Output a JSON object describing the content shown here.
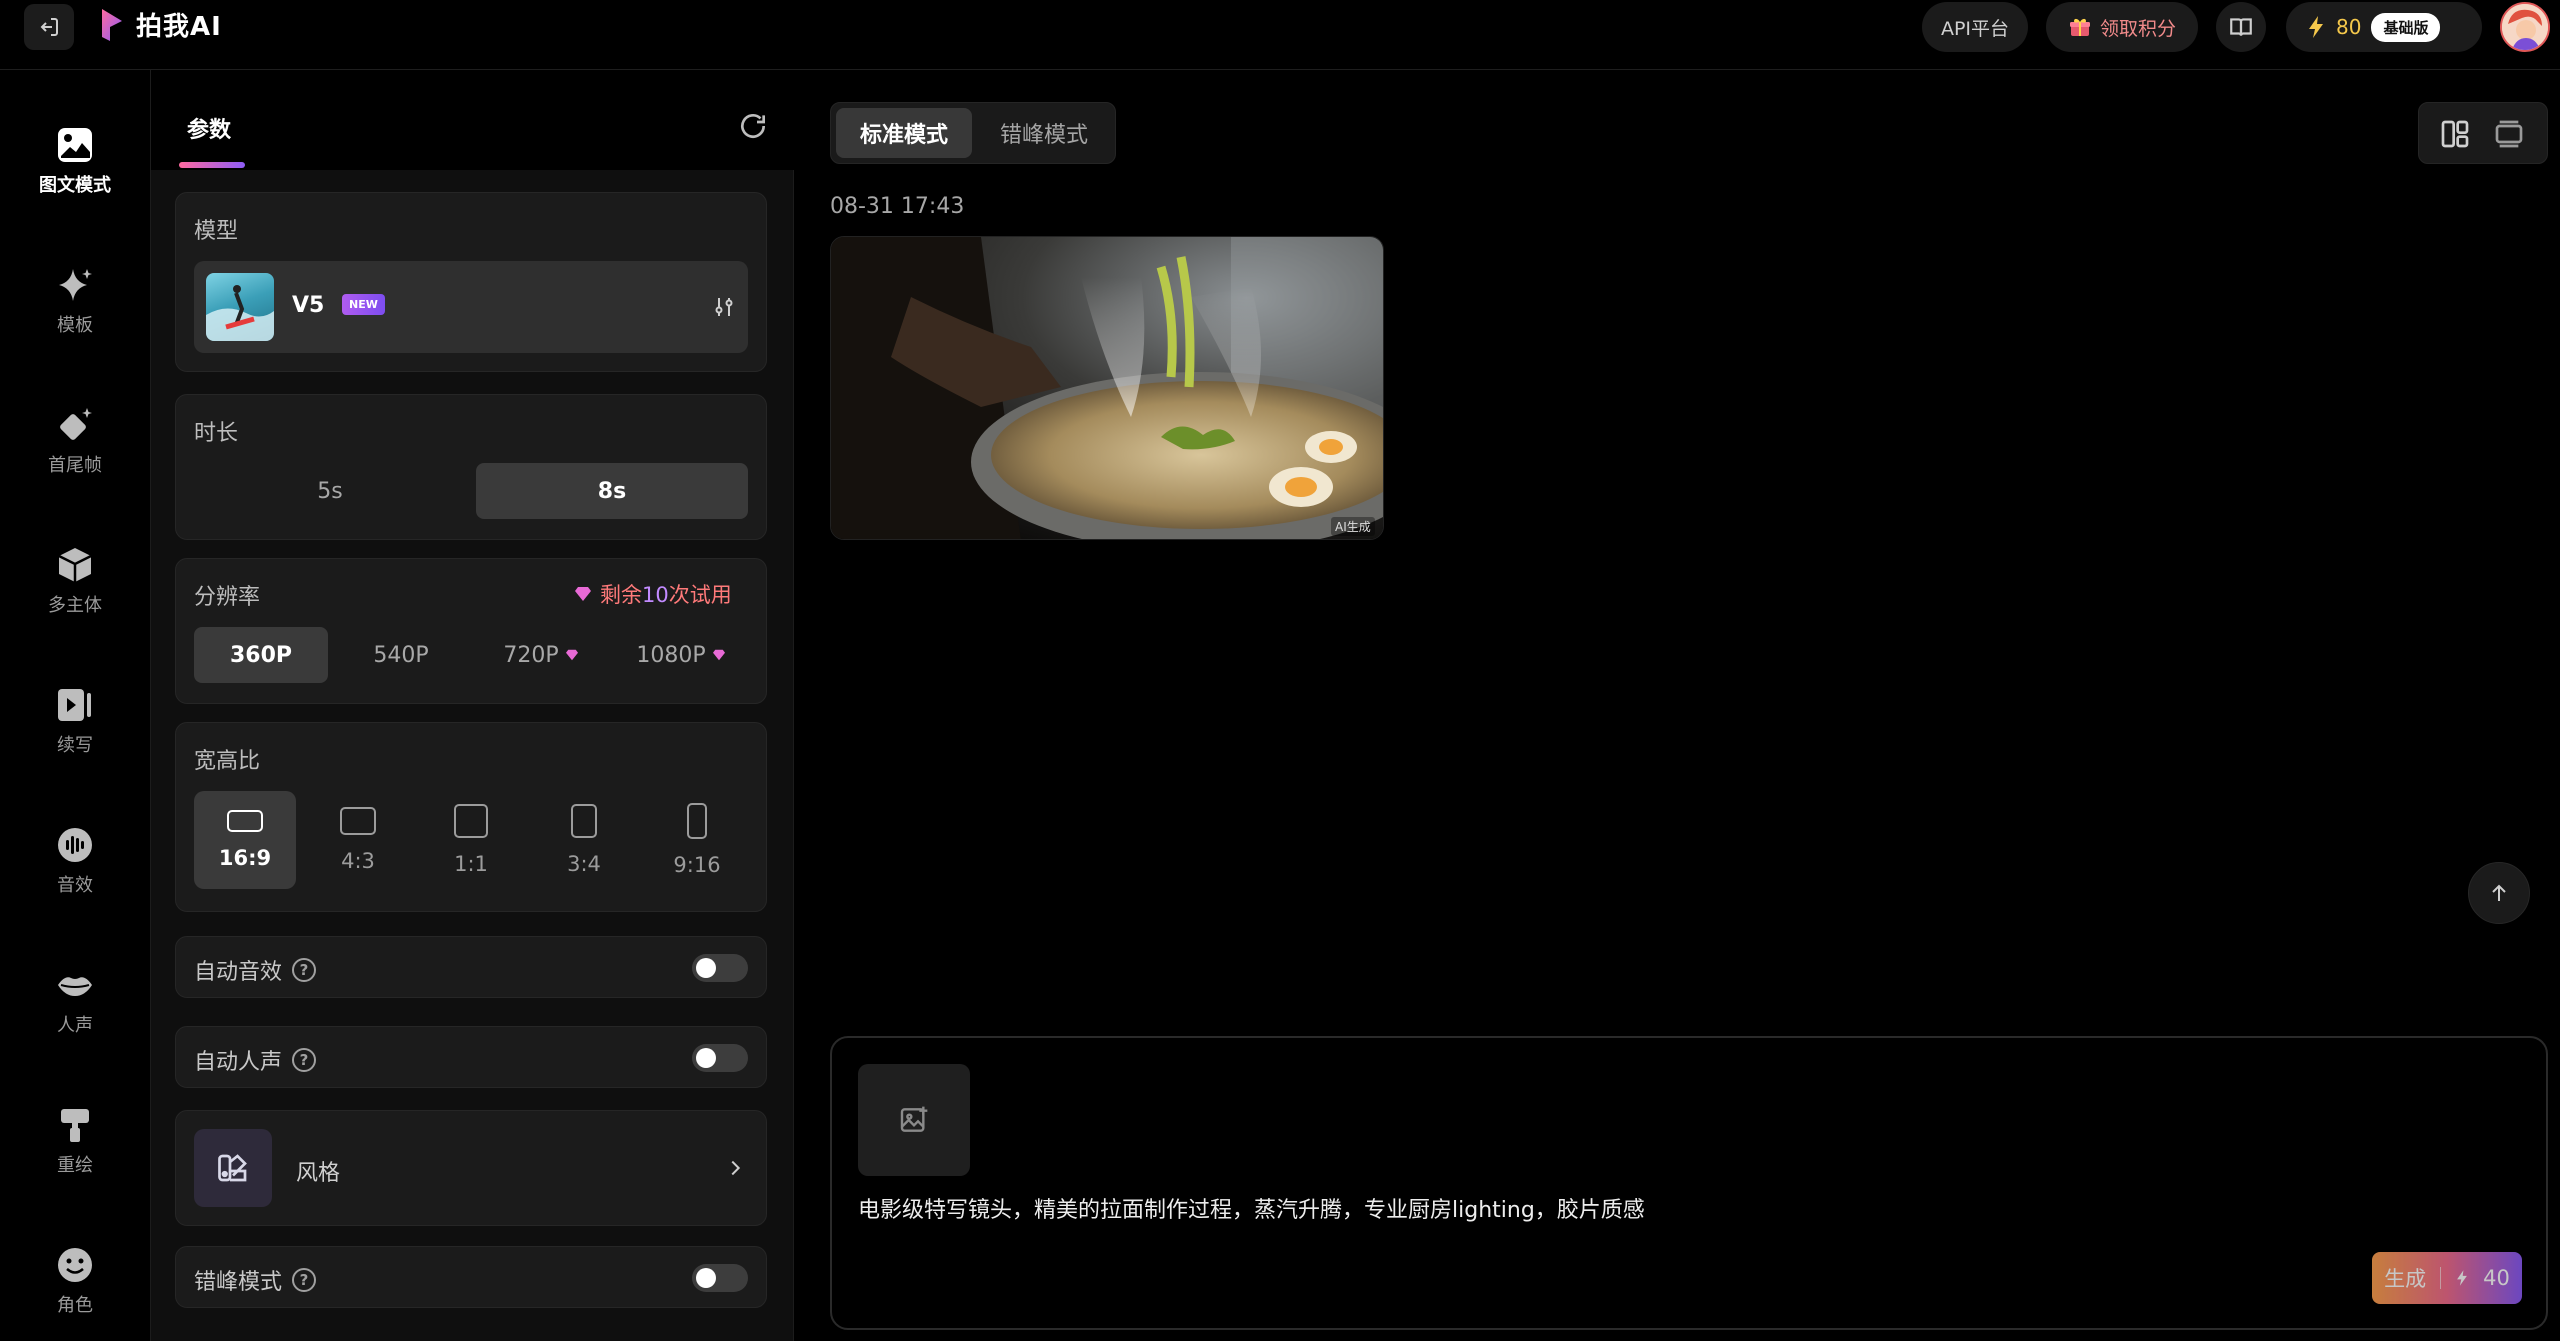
{
  "app": {
    "name": "拍我AI"
  },
  "header": {
    "api_label": "API平台",
    "gift_label": "领取积分",
    "credits": "80",
    "plan": "基础版"
  },
  "nav": [
    {
      "id": "image-text",
      "label": "图文模式",
      "icon": "image-icon",
      "active": true
    },
    {
      "id": "template",
      "label": "模板",
      "icon": "sparkle-icon"
    },
    {
      "id": "first-last-frame",
      "label": "首尾帧",
      "icon": "diamond-sparkle-icon"
    },
    {
      "id": "multi-subject",
      "label": "多主体",
      "icon": "cube-icon"
    },
    {
      "id": "continue",
      "label": "续写",
      "icon": "video-play-icon"
    },
    {
      "id": "sfx",
      "label": "音效",
      "icon": "audio-wave-icon"
    },
    {
      "id": "voice",
      "label": "人声",
      "icon": "lips-icon"
    },
    {
      "id": "repaint",
      "label": "重绘",
      "icon": "paint-roller-icon"
    },
    {
      "id": "character",
      "label": "角色",
      "icon": "smiley-icon"
    }
  ],
  "panel": {
    "title": "参数",
    "model": {
      "label": "模型",
      "name": "V5",
      "badge": "NEW"
    },
    "duration": {
      "label": "时长",
      "options": [
        "5s",
        "8s"
      ],
      "selected": "8s"
    },
    "resolution": {
      "label": "分辨率",
      "trial_prefix": "剩余",
      "trial_count": "10",
      "trial_suffix": "次试用",
      "options": [
        "360P",
        "540P",
        "720P",
        "1080P"
      ],
      "selected": "360P"
    },
    "aspect": {
      "label": "宽高比",
      "options": [
        "16:9",
        "4:3",
        "1:1",
        "3:4",
        "9:16"
      ],
      "selected": "16:9"
    },
    "auto_sfx": {
      "label": "自动音效",
      "on": false
    },
    "auto_voice": {
      "label": "自动人声",
      "on": false
    },
    "style": {
      "label": "风格"
    },
    "offpeak": {
      "label": "错峰模式",
      "on": false
    }
  },
  "main": {
    "tabs": [
      "标准模式",
      "错峰模式"
    ],
    "selected_tab": "标准模式",
    "timestamp": "08-31 17:43",
    "ai_tag": "AI生成",
    "prompt": "电影级特写镜头，精美的拉面制作过程，蒸汽升腾，专业厨房lighting，胶片质感",
    "generate_label": "生成",
    "generate_cost": "40"
  },
  "colors": {
    "accent_pink": "#f26d8e",
    "accent_purple": "#8b5cf6",
    "accent_orange": "#ffa24f",
    "credits_yellow": "#f5c84b"
  }
}
